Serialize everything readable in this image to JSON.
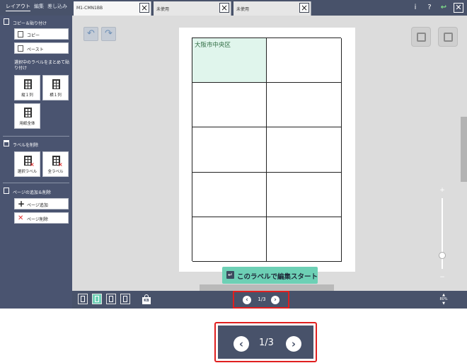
{
  "menu_tabs": [
    "レイアウト",
    "編集",
    "差し込み"
  ],
  "doc_tabs": [
    {
      "label": "M1-CMN1BB",
      "active": true
    },
    {
      "label": "未使用",
      "active": false
    },
    {
      "label": "未使用",
      "active": false
    }
  ],
  "top_buttons": {
    "info": "i",
    "help": "?",
    "undo": "↩",
    "close": "✕"
  },
  "sidebar": {
    "copy_section": {
      "title": "コピー＆貼り付け",
      "copy_label": "コピー",
      "paste_label": "ペースト"
    },
    "bulk_section": {
      "title": "選択中のラベルをまとめて貼り付け",
      "tiles": [
        "縦１列",
        "横１列",
        "用紙全体"
      ]
    },
    "delete_section": {
      "title": "ラベルを削除",
      "tiles": [
        "選択ラベル",
        "全ラベル"
      ]
    },
    "page_section": {
      "title": "ページの追加＆削除",
      "add_label": "ページ追加",
      "delete_label": "ページ削除"
    }
  },
  "canvas": {
    "first_cell_text": "大阪市中央区",
    "start_button": "このラベルで編集スタート",
    "zoom_plus": "+",
    "zoom_minus": "−"
  },
  "pager": {
    "text": "1/3",
    "prev": "‹",
    "next": "›"
  },
  "zoom": {
    "value": "80%"
  },
  "icons": {
    "kb": "KB"
  },
  "colors": {
    "chrome": "#48526a",
    "accent": "#6dd0b5",
    "highlight": "#e01f1f",
    "selected_cell": "#e0f5ec"
  }
}
